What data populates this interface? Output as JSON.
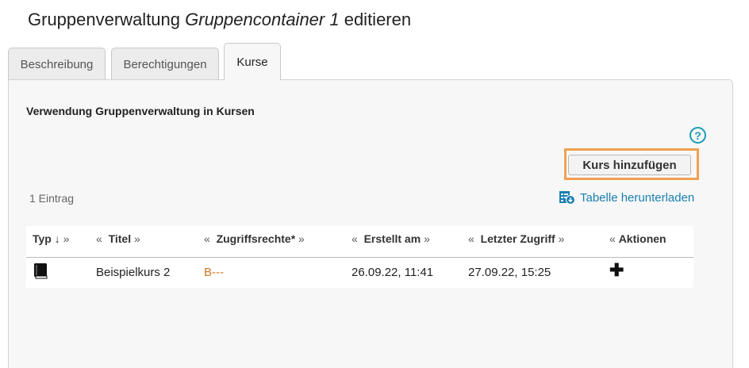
{
  "page": {
    "title_prefix": "Gruppenverwaltung ",
    "title_italic": "Gruppencontainer 1",
    "title_suffix": " editieren"
  },
  "tabs": [
    {
      "label": "Beschreibung"
    },
    {
      "label": "Berechtigungen"
    },
    {
      "label": "Kurse"
    }
  ],
  "panel": {
    "section_title": "Verwendung Gruppenverwaltung in Kursen",
    "help_symbol": "?",
    "add_button": "Kurs hinzufügen",
    "entry_count": "1 Eintrag",
    "download_label": "Tabelle herunterladen"
  },
  "table": {
    "headers": [
      {
        "label": "Typ ↓",
        "left_arrow": "",
        "right_arrow": "»"
      },
      {
        "label": "Titel",
        "left_arrow": "«",
        "right_arrow": "»"
      },
      {
        "label": "Zugriffsrechte*",
        "left_arrow": "«",
        "right_arrow": "»"
      },
      {
        "label": "Erstellt am",
        "left_arrow": "«",
        "right_arrow": "»"
      },
      {
        "label": "Letzter Zugriff",
        "left_arrow": "«",
        "right_arrow": "»"
      },
      {
        "label": "Aktionen",
        "left_arrow": "«",
        "right_arrow": ""
      }
    ],
    "rows": [
      {
        "type_icon": "book-icon",
        "title": "Beispielkurs 2",
        "rights": "B---",
        "created": "26.09.22, 11:41",
        "last_access": "27.09.22, 15:25",
        "action_icon": "plus-icon"
      }
    ]
  },
  "colors": {
    "accent_link": "#1a7fb0",
    "help": "#1a9bb5",
    "highlight": "#f0a050",
    "rights_text": "#d07820"
  }
}
